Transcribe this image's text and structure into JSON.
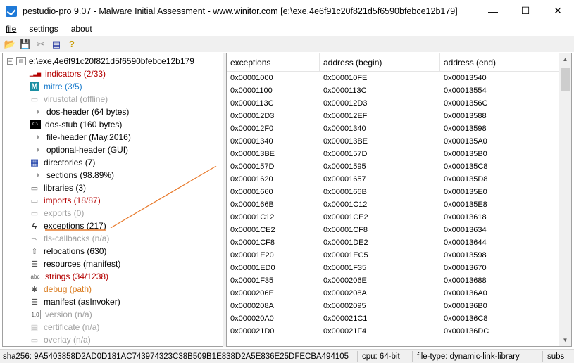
{
  "window": {
    "title": "pestudio-pro 9.07 - Malware Initial Assessment - www.winitor.com [e:\\exe,4e6f91c20f821d5f6590bfebce12b179]",
    "minimize": "—",
    "maximize": "☐",
    "close": "✕"
  },
  "menu": [
    {
      "label": "file"
    },
    {
      "label": "settings"
    },
    {
      "label": "about"
    }
  ],
  "toolbar": {
    "open": "📂",
    "save": "💾",
    "cut": "✂",
    "list": "▤",
    "help": "?"
  },
  "tree": {
    "root": "e:\\exe,4e6f91c20f821d5f6590bfebce12b179",
    "items": [
      {
        "label": "indicators (2/33)",
        "color": "#b40000",
        "icon": "chart-icon"
      },
      {
        "label": "mitre (3/5)",
        "color": "#1b7ccc",
        "icon": "mitre-icon"
      },
      {
        "label": "virustotal (offline)",
        "color": "#a0a0a0",
        "icon": "virustotal-icon"
      },
      {
        "label": "dos-header (64 bytes)",
        "color": "#000000",
        "icon": "arrow-icon"
      },
      {
        "label": "dos-stub (160 bytes)",
        "color": "#000000",
        "icon": "cmd-icon"
      },
      {
        "label": "file-header (May.2016)",
        "color": "#000000",
        "icon": "arrow-icon"
      },
      {
        "label": "optional-header (GUI)",
        "color": "#000000",
        "icon": "arrow-icon"
      },
      {
        "label": "directories (7)",
        "color": "#000000",
        "icon": "directories-icon"
      },
      {
        "label": "sections (98.89%)",
        "color": "#000000",
        "icon": "arrow-icon"
      },
      {
        "label": "libraries (3)",
        "color": "#000000",
        "icon": "libraries-icon"
      },
      {
        "label": "imports (18/87)",
        "color": "#b40000",
        "icon": "imports-icon"
      },
      {
        "label": "exports (0)",
        "color": "#a0a0a0",
        "icon": "exports-icon"
      },
      {
        "label": "exceptions (217)",
        "color": "#000000",
        "icon": "exceptions-icon"
      },
      {
        "label": "tls-callbacks (n/a)",
        "color": "#a0a0a0",
        "icon": "tls-icon"
      },
      {
        "label": "relocations (630)",
        "color": "#000000",
        "icon": "relocations-icon"
      },
      {
        "label": "resources (manifest)",
        "color": "#000000",
        "icon": "resources-icon"
      },
      {
        "label": "strings (34/1238)",
        "color": "#b40000",
        "icon": "strings-icon"
      },
      {
        "label": "debug (path)",
        "color": "#d97a1d",
        "icon": "debug-icon"
      },
      {
        "label": "manifest (asInvoker)",
        "color": "#000000",
        "icon": "manifest-icon"
      },
      {
        "label": "version (n/a)",
        "color": "#a0a0a0",
        "icon": "version-icon"
      },
      {
        "label": "certificate (n/a)",
        "color": "#a0a0a0",
        "icon": "certificate-icon"
      },
      {
        "label": "overlay (n/a)",
        "color": "#a0a0a0",
        "icon": "overlay-icon"
      }
    ]
  },
  "table": {
    "columns": [
      "exceptions",
      "address (begin)",
      "address (end)"
    ],
    "rows": [
      [
        "0x00001000",
        "0x000010FE",
        "0x00013540"
      ],
      [
        "0x00001100",
        "0x0000113C",
        "0x00013554"
      ],
      [
        "0x0000113C",
        "0x000012D3",
        "0x0001356C"
      ],
      [
        "0x000012D3",
        "0x000012EF",
        "0x00013588"
      ],
      [
        "0x000012F0",
        "0x00001340",
        "0x00013598"
      ],
      [
        "0x00001340",
        "0x000013BE",
        "0x000135A0"
      ],
      [
        "0x000013BE",
        "0x0000157D",
        "0x000135B0"
      ],
      [
        "0x0000157D",
        "0x00001595",
        "0x000135C8"
      ],
      [
        "0x00001620",
        "0x00001657",
        "0x000135D8"
      ],
      [
        "0x00001660",
        "0x0000166B",
        "0x000135E0"
      ],
      [
        "0x0000166B",
        "0x00001C12",
        "0x000135E8"
      ],
      [
        "0x00001C12",
        "0x00001CE2",
        "0x00013618"
      ],
      [
        "0x00001CE2",
        "0x00001CF8",
        "0x00013634"
      ],
      [
        "0x00001CF8",
        "0x00001DE2",
        "0x00013644"
      ],
      [
        "0x00001E20",
        "0x00001EC5",
        "0x00013598"
      ],
      [
        "0x00001ED0",
        "0x00001F35",
        "0x00013670"
      ],
      [
        "0x00001F35",
        "0x0000206E",
        "0x00013688"
      ],
      [
        "0x0000206E",
        "0x0000208A",
        "0x000136A0"
      ],
      [
        "0x0000208A",
        "0x00002095",
        "0x000136B0"
      ],
      [
        "0x000020A0",
        "0x000021C1",
        "0x000136C8"
      ],
      [
        "0x000021D0",
        "0x000021F4",
        "0x000136DC"
      ]
    ]
  },
  "status": {
    "sha256": "sha256: 9A5403858D2AD0D181AC743974323C38B509B1E838D2A5E836E25DFECBA494105",
    "cpu": "cpu: 64-bit",
    "filetype": "file-type: dynamic-link-library",
    "subsystem": "subs"
  },
  "colors": {
    "highlight_annotation": "#e8792a"
  }
}
